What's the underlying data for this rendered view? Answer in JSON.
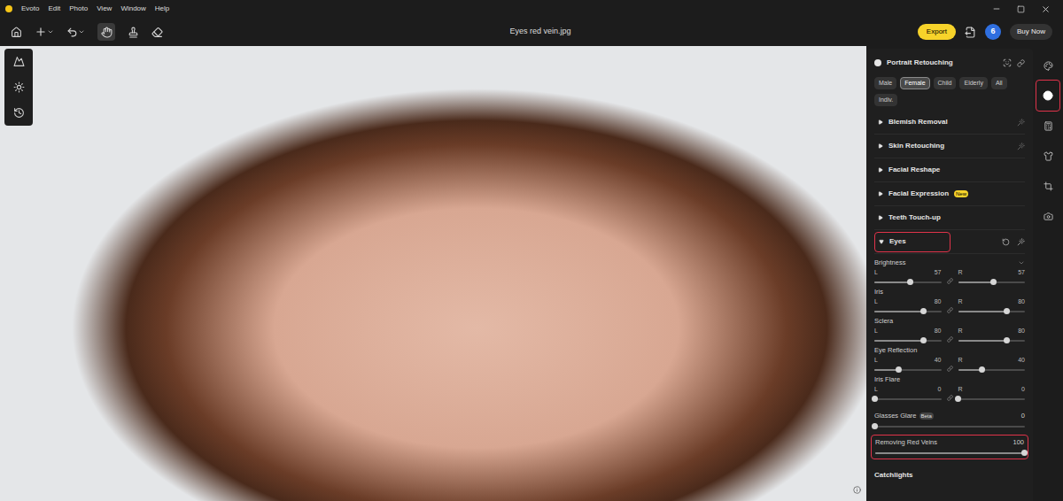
{
  "menu": [
    "Evoto",
    "Edit",
    "Photo",
    "View",
    "Window",
    "Help"
  ],
  "window": {
    "title": "Eyes red vein.jpg"
  },
  "toolbar": {
    "export": "Export",
    "credits": "6",
    "buy": "Buy Now"
  },
  "panel": {
    "title": "Portrait Retouching",
    "filters": [
      {
        "label": "Male",
        "selected": false
      },
      {
        "label": "Female",
        "selected": true
      },
      {
        "label": "Child",
        "selected": false
      },
      {
        "label": "Elderly",
        "selected": false
      },
      {
        "label": "All",
        "selected": false
      },
      {
        "label": "Indiv.",
        "selected": false
      }
    ],
    "sections": [
      {
        "label": "Blemish Removal",
        "expanded": false,
        "highlighted": false
      },
      {
        "label": "Skin Retouching",
        "expanded": false,
        "highlighted": false
      },
      {
        "label": "Facial Reshape",
        "expanded": false,
        "highlighted": false
      },
      {
        "label": "Facial Expression",
        "badge": "New",
        "expanded": false,
        "highlighted": false
      },
      {
        "label": "Teeth Touch-up",
        "expanded": false,
        "highlighted": false
      },
      {
        "label": "Eyes",
        "expanded": true,
        "highlighted": true
      }
    ],
    "sliders": [
      {
        "kind": "pair",
        "label": "Brightness",
        "highlighted": false,
        "left": {
          "side": "L",
          "value": "57",
          "level": 0.53
        },
        "right": {
          "side": "R",
          "value": "57",
          "level": 0.53
        }
      },
      {
        "kind": "pair",
        "label": "Iris",
        "highlighted": false,
        "left": {
          "side": "L",
          "value": "80",
          "level": 0.73
        },
        "right": {
          "side": "R",
          "value": "80",
          "level": 0.73
        }
      },
      {
        "kind": "pair",
        "label": "Sclera",
        "highlighted": false,
        "left": {
          "side": "L",
          "value": "80",
          "level": 0.73
        },
        "right": {
          "side": "R",
          "value": "80",
          "level": 0.73
        }
      },
      {
        "kind": "pair",
        "label": "Eye Reflection",
        "highlighted": false,
        "left": {
          "side": "L",
          "value": "40",
          "level": 0.36
        },
        "right": {
          "side": "R",
          "value": "40",
          "level": 0.36
        }
      },
      {
        "kind": "pair",
        "label": "Iris Flare",
        "highlighted": false,
        "left": {
          "side": "L",
          "value": "0",
          "level": 0
        },
        "right": {
          "side": "R",
          "value": "0",
          "level": 0
        }
      },
      {
        "kind": "single",
        "label": "Glasses Glare",
        "badge": "Beta",
        "value": "0",
        "level": 0,
        "highlighted": false
      },
      {
        "kind": "single",
        "label": "Removing Red Veins",
        "value": "100",
        "level": 1,
        "highlighted": true
      }
    ],
    "catchlights": "Catchlights"
  },
  "side_icons": [
    {
      "selected": false,
      "highlighted": false
    },
    {
      "selected": true,
      "highlighted": true
    },
    {
      "selected": false,
      "highlighted": false
    },
    {
      "selected": false,
      "highlighted": false
    },
    {
      "selected": false,
      "highlighted": false
    },
    {
      "selected": false,
      "highlighted": false
    }
  ]
}
